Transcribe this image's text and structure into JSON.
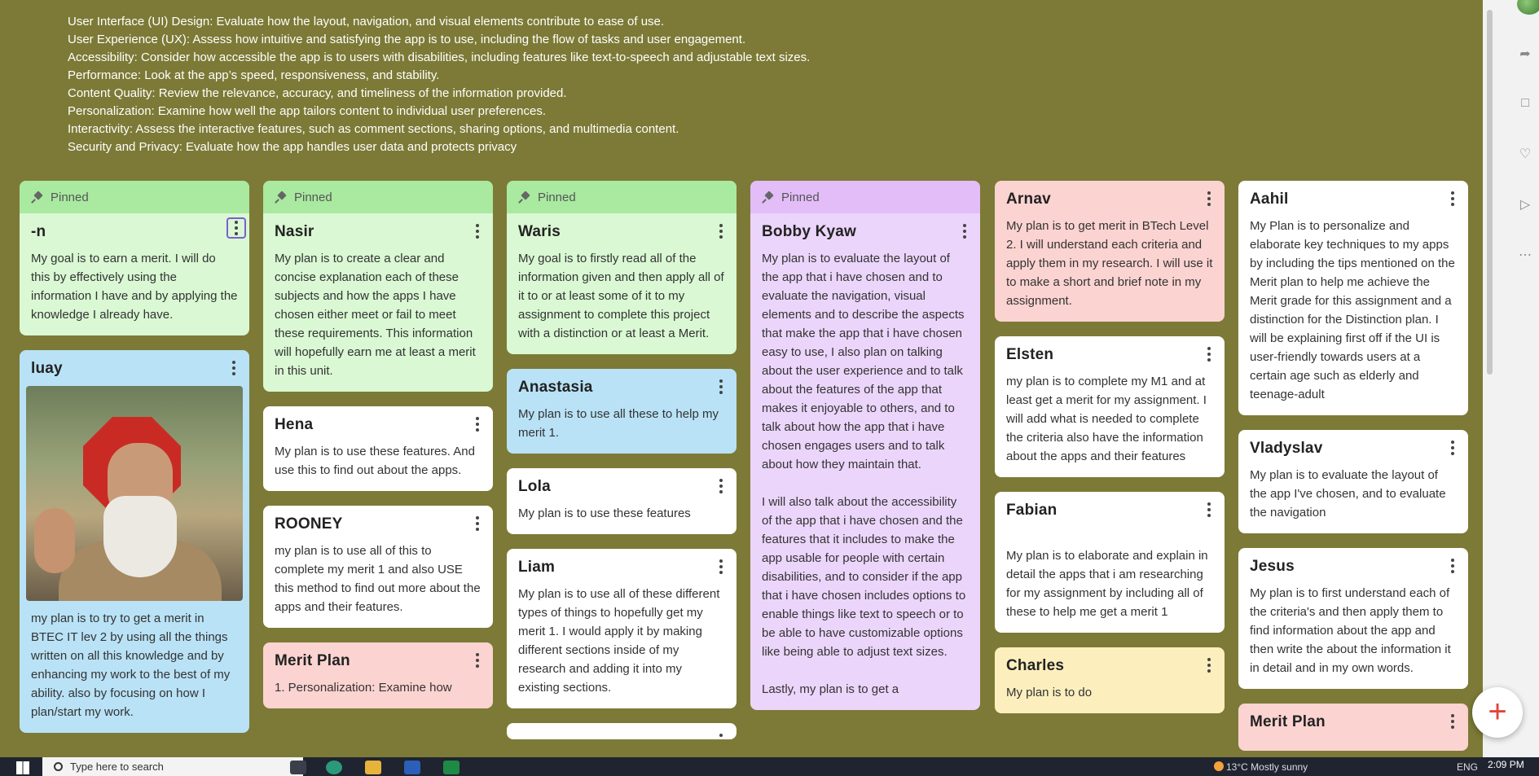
{
  "criteria": [
    "User Interface (UI) Design: Evaluate how the layout, navigation, and visual elements contribute to ease of use.",
    "User Experience (UX): Assess how intuitive and satisfying the app is to use, including the flow of tasks and user engagement.",
    "Accessibility: Consider how accessible the app is to users with disabilities, including features like text-to-speech and adjustable text sizes.",
    "Performance: Look at the app’s speed, responsiveness, and stability.",
    "Content Quality: Review the relevance, accuracy, and timeliness of the information provided.",
    "Personalization: Examine how well the app tailors content to individual user preferences.",
    "Interactivity: Assess the interactive features, such as comment sections, sharing options, and multimedia content.",
    "Security and Privacy: Evaluate how the app handles user data and protects privacy"
  ],
  "pinned_label": "Pinned",
  "columns": [
    [
      {
        "pinned": true,
        "color": "green",
        "author": "-n",
        "focused_menu": true,
        "text": "My goal is to earn a merit. I will do this by effectively using the information I have and by applying the knowledge I already have."
      },
      {
        "pinned": false,
        "color": "blue",
        "author": "luay",
        "image": "old-man-with-stop-sign-photo",
        "text": "my plan is to try to get a merit in BTEC IT lev 2 by using all the things written on all this knowledge and by enhancing my work to the best of my ability. also by focusing  on how I plan/start my work."
      }
    ],
    [
      {
        "pinned": true,
        "color": "green",
        "author": "Nasir",
        "text": "My plan is to create a clear and concise explanation each of these subjects and how the apps I have chosen either meet or fail to meet these requirements. This information will hopefully earn me at least a merit in this unit."
      },
      {
        "pinned": false,
        "color": "white",
        "author": "Hena",
        "text": "My plan is to use these features. And use this to find out  about the apps."
      },
      {
        "pinned": false,
        "color": "white",
        "author": "ROONEY",
        "text": "my plan is to use all of this to complete my merit 1 and also USE this method to find out more about the apps and their features."
      },
      {
        "pinned": false,
        "color": "pink",
        "author": "Merit Plan",
        "text": "1. Personalization: Examine how"
      }
    ],
    [
      {
        "pinned": true,
        "color": "green",
        "author": "Waris",
        "text": "My goal is to firstly read all of the information given and then apply all of it to or at least some of it to my assignment to complete this project with a distinction or at least a Merit."
      },
      {
        "pinned": false,
        "color": "blue",
        "author": "Anastasia",
        "text": "My plan is to use all these to help my merit 1."
      },
      {
        "pinned": false,
        "color": "white",
        "author": "Lola",
        "text": "My plan is to use these features"
      },
      {
        "pinned": false,
        "color": "white",
        "author": "Liam",
        "text": "My plan is to use all of these different types of things to hopefully get my merit 1. I would apply it by making different sections inside of my research and adding it into my existing sections."
      },
      {
        "pinned": false,
        "color": "white",
        "author": "",
        "text": ""
      }
    ],
    [
      {
        "pinned": true,
        "color": "purple",
        "author": "Bobby Kyaw",
        "text": "My plan is to evaluate the layout of the app that i have chosen and to evaluate the navigation, visual elements and to describe the aspects that make the app that i have chosen easy to use, I also plan on talking about the user experience and to talk about the features of the app that makes it enjoyable to others, and to talk about how the app that i have chosen engages users and to talk about how they maintain that.\n\nI will also talk about the accessibility of the app that i have chosen and the features that it includes to make the app usable for people with certain disabilities, and to consider if the app that i have chosen includes options to enable things like text to speech or to be able to have customizable options like being able to adjust text sizes.\n\nLastly, my plan is to get a"
      }
    ],
    [
      {
        "pinned": false,
        "color": "pink",
        "author": "Arnav",
        "text": "My plan is to get merit in BTech Level 2. I will understand each criteria and apply them in my research. I will use it to make a short and brief note in my assignment."
      },
      {
        "pinned": false,
        "color": "white",
        "author": "Elsten",
        "text": "my plan is to complete my M1 and at least get a merit for my assignment. I will add what is needed to complete the criteria also have the information about the apps and their features"
      },
      {
        "pinned": false,
        "color": "white",
        "author": "Fabian",
        "text": "\nMy plan is to elaborate and explain in detail the apps that i am researching for my assignment by including all of these to help me get a merit 1"
      },
      {
        "pinned": false,
        "color": "yellow",
        "author": "Charles",
        "text": "My plan is to do"
      }
    ],
    [
      {
        "pinned": false,
        "color": "white",
        "author": "Aahil",
        "text": "My Plan is to personalize and elaborate key techniques to my apps by including the tips mentioned on the Merit plan to help me achieve the Merit grade for this assignment and a distinction for the Distinction plan. I will be explaining first off if the UI is user-friendly towards users at a certain age such as elderly and teenage-adult"
      },
      {
        "pinned": false,
        "color": "white",
        "author": "Vladyslav",
        "text": "My plan is to evaluate the layout of the app I've chosen, and to evaluate the navigation"
      },
      {
        "pinned": false,
        "color": "white",
        "author": "Jesus",
        "text": "My plan is to first understand each of the criteria's and then apply them to find information about the app and then write the about the information it in detail and in my own words."
      },
      {
        "pinned": false,
        "color": "pink",
        "author": "Merit Plan",
        "text": ""
      }
    ]
  ],
  "taskbar": {
    "search_placeholder": "Type here to search",
    "weather": "13°C  Mostly sunny",
    "language": "ENG",
    "time": "2:09 PM"
  },
  "icons": {
    "rightbar": [
      "share-icon",
      "slideshow-icon",
      "bell-icon",
      "play-icon",
      "more-icon"
    ],
    "fab": "plus-icon"
  }
}
